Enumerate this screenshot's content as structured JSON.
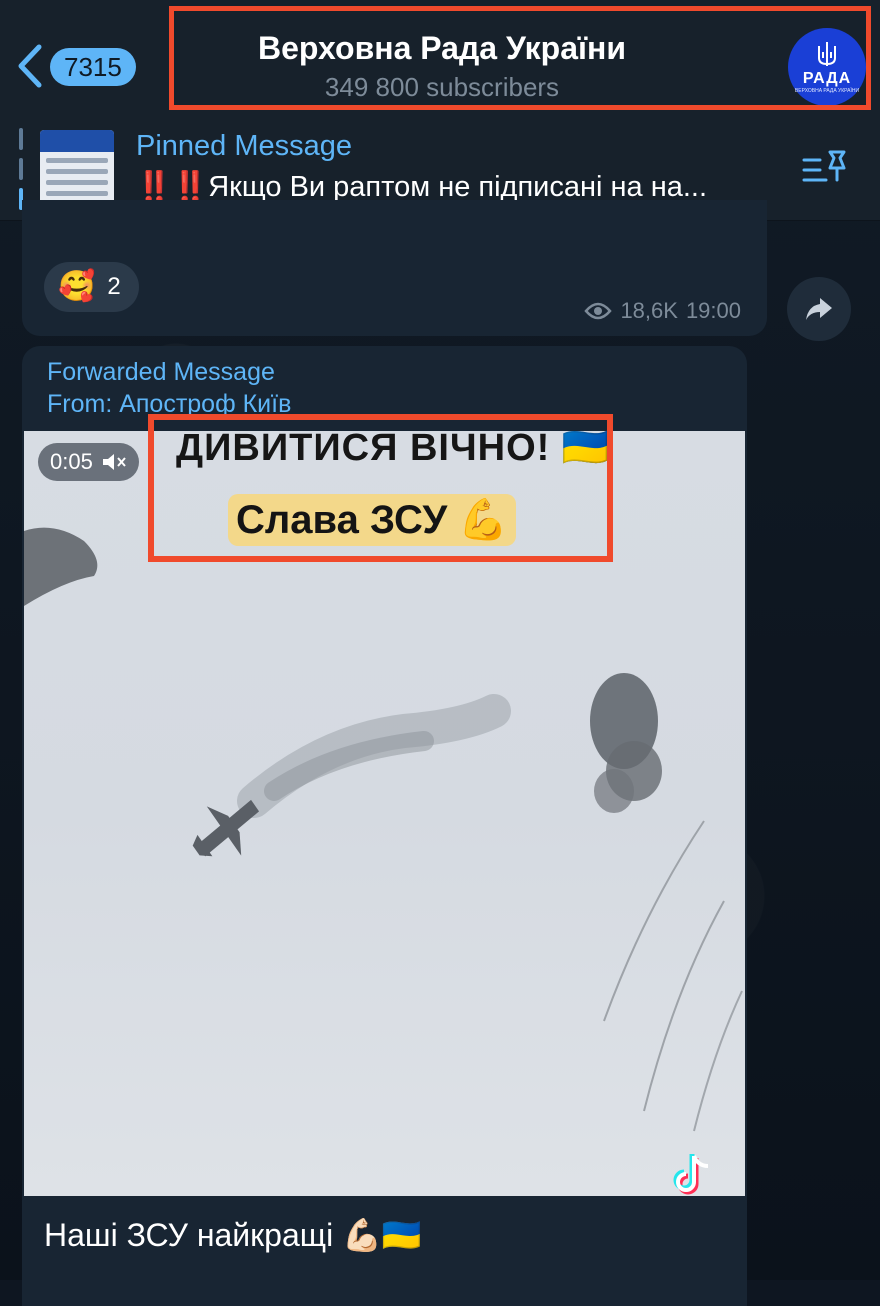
{
  "header": {
    "back_count": "7315",
    "title": "Верховна Рада України",
    "subscribers": "349 800 subscribers",
    "avatar_label": "РАДА",
    "avatar_small": "ВЕРХОВНА РАДА УКРАЇНИ"
  },
  "pinned": {
    "title": "Pinned Message",
    "text": "‼️‼️Якщо Ви раптом не підписані на на..."
  },
  "message1": {
    "reactions": [
      {
        "emoji": "🥰",
        "count": "2"
      }
    ],
    "views": "18,6K",
    "time": "19:00"
  },
  "message2": {
    "forwarded_label": "Forwarded Message",
    "from_label": "From: Апостроф Київ",
    "video_duration": "0:05",
    "caption_line1": "ДИВИТИСЯ ВІЧНО! 🇺🇦",
    "caption_line2": "Слава ЗСУ 💪",
    "text": "Наші ЗСУ найкращі 💪🏻🇺🇦"
  },
  "colors": {
    "accent": "#5eb5f7",
    "highlight_border": "#f04a2c",
    "bubble": "#182533",
    "header_bg": "#17212b"
  },
  "icons": [
    "chevron-left-icon",
    "pin-list-icon",
    "eye-icon",
    "share-icon",
    "mute-icon",
    "tiktok-icon"
  ]
}
